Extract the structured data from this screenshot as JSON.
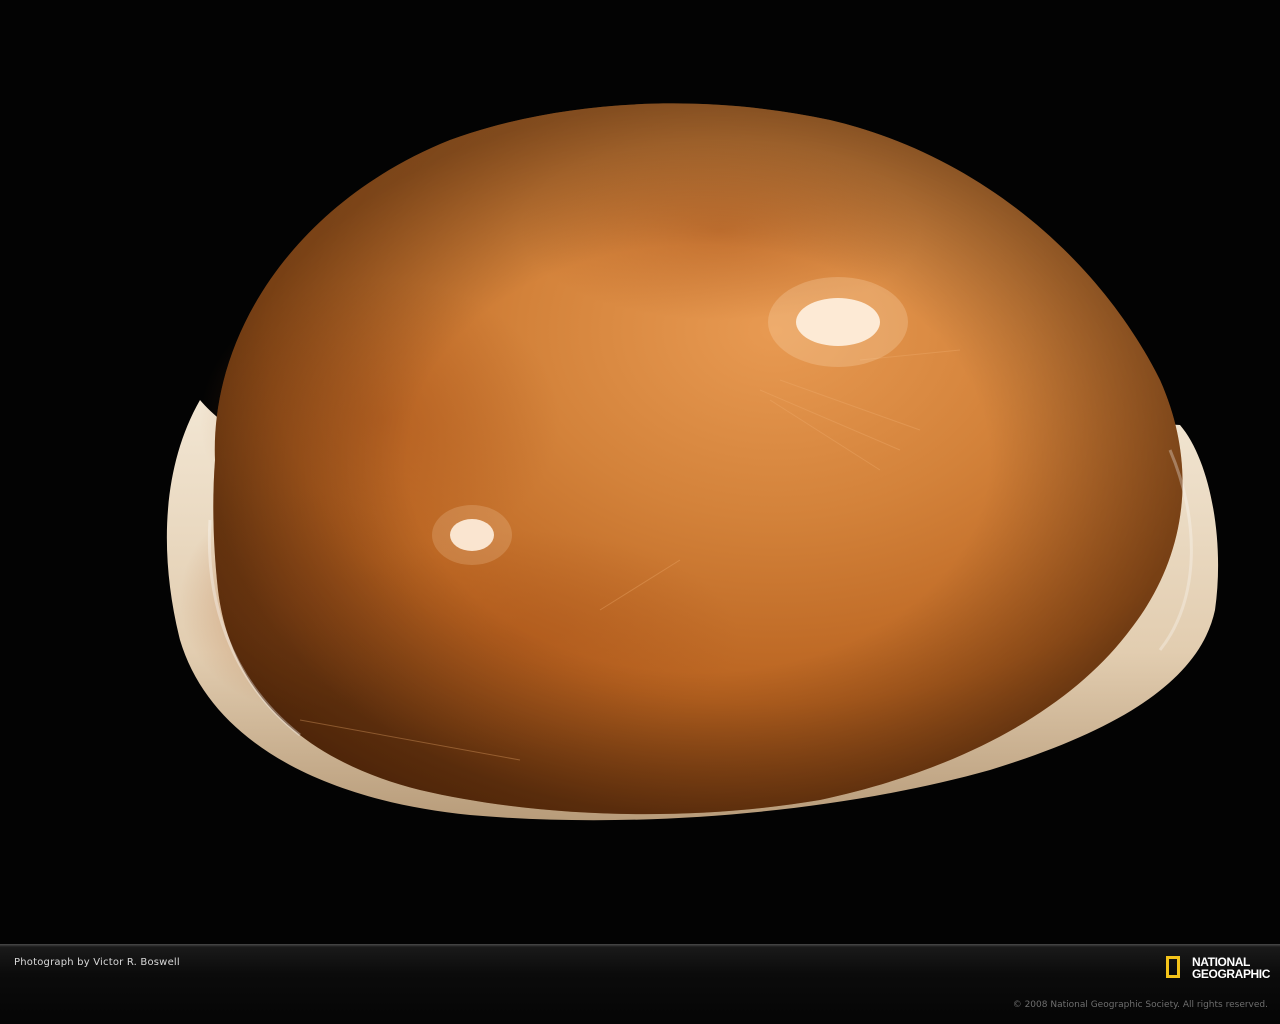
{
  "photo": {
    "subject": "cowrie-shell",
    "background_color": "#030303",
    "shell_color": "#c8702a",
    "lip_color": "#e4d3bc"
  },
  "footer": {
    "credit": "Photograph by Victor R. Boswell",
    "brand_line1": "NATIONAL",
    "brand_line2": "GEOGRAPHIC",
    "brand_color": "#f3c31a",
    "copyright": "© 2008 National Geographic Society. All rights reserved."
  }
}
